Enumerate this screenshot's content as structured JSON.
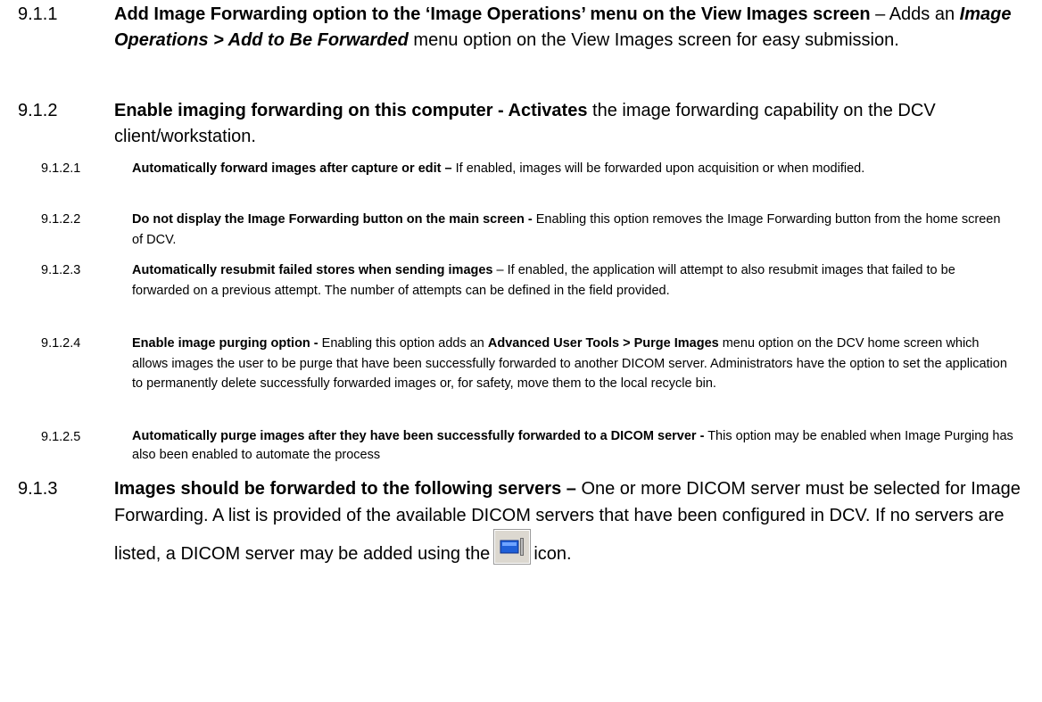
{
  "sections": [
    {
      "number": "9.1.1",
      "title": "Add Image Forwarding option to the ‘Image Operations’ menu on the View Images screen",
      "sep": " – Adds an ",
      "emph": "Image Operations > Add to Be Forwarded",
      "tail": " menu option on the View Images screen for easy submission."
    },
    {
      "number": "9.1.2",
      "title": "Enable imaging forwarding on this computer - Activates",
      "tail": " the image forwarding capability on the DCV client/workstation."
    },
    {
      "number": "9.1.3",
      "title": "Images should be forwarded to the following servers –",
      "tail": " One or more DICOM server must be selected for Image Forwarding. A list is provided of the available DICOM servers that have been configured in DCV. If no servers are listed, a DICOM server may be added using the",
      "tail_end": "icon.",
      "icon": "dicom-server-add-icon"
    }
  ],
  "subsections": [
    {
      "number": "9.1.2.1",
      "title": "Automatically forward images after capture or edit –",
      "tail": " If enabled, images will be forwarded upon acquisition or when modified."
    },
    {
      "number": "9.1.2.2",
      "title": "Do not display the Image Forwarding button on the main screen -",
      "tail": " Enabling this option removes the Image Forwarding button from the home screen of DCV."
    },
    {
      "number": "9.1.2.3",
      "title": "Automatically resubmit failed stores when sending images",
      "tail": " – If enabled, the application will attempt to also resubmit images that failed to be forwarded on a previous attempt.  The number of attempts can be defined in the field provided."
    },
    {
      "number": "9.1.2.4",
      "title": "Enable image purging option -",
      "tail": " Enabling this option adds an ",
      "bold2": "Advanced User Tools > Purge Images",
      "tail2": " menu option on the DCV home screen which allows images the user to be purge that have been successfully forwarded to another DICOM server. Administrators have the option to set the application to permanently delete successfully forwarded images or, for safety, move them to the local recycle bin."
    },
    {
      "number": "9.1.2.5",
      "title": "Automatically purge images after they have been successfully forwarded to a DICOM server -",
      "tail": " This option may be enabled when Image Purging has also been enabled to automate the process"
    }
  ]
}
